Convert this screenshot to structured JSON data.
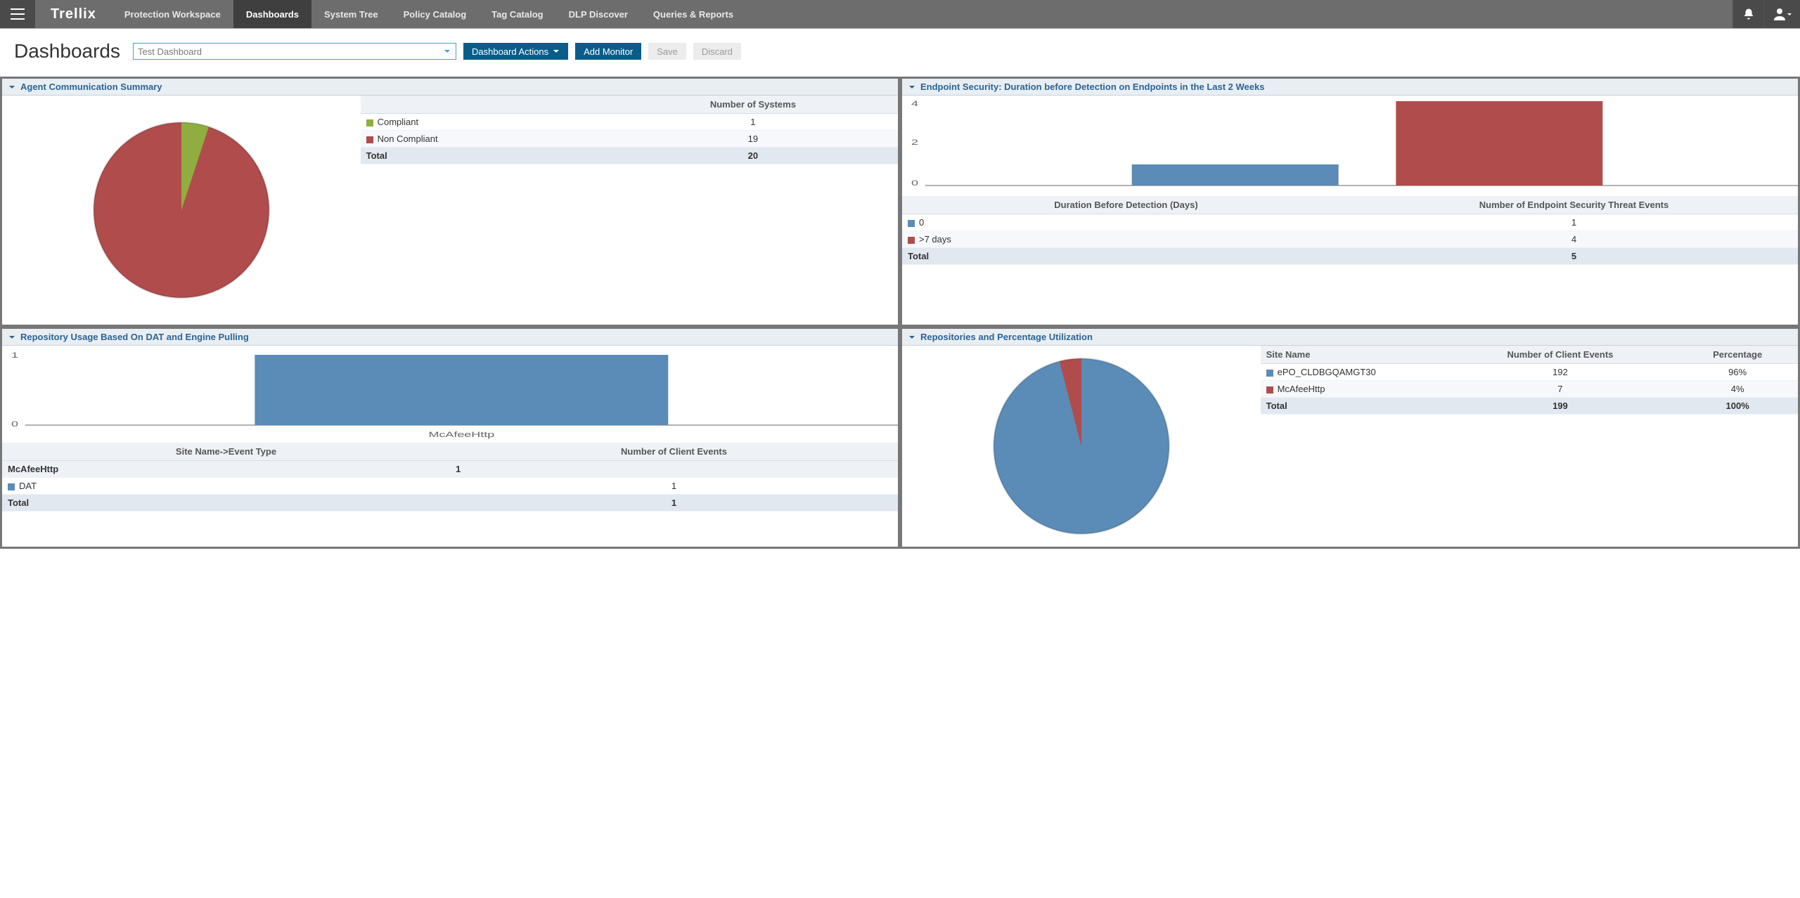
{
  "brand": "Trellix",
  "nav": {
    "items": [
      {
        "label": "Protection Workspace"
      },
      {
        "label": "Dashboards",
        "active": true
      },
      {
        "label": "System Tree"
      },
      {
        "label": "Policy Catalog"
      },
      {
        "label": "Tag Catalog"
      },
      {
        "label": "DLP Discover"
      },
      {
        "label": "Queries & Reports"
      }
    ]
  },
  "page": {
    "title": "Dashboards",
    "selected_dashboard": "Test Dashboard",
    "btn_actions": "Dashboard Actions",
    "btn_add": "Add Monitor",
    "btn_save": "Save",
    "btn_discard": "Discard"
  },
  "colors": {
    "blue": "#5b8bb7",
    "red": "#b04c4c",
    "green": "#8fae3f"
  },
  "panels": {
    "agent": {
      "title": "Agent Communication Summary",
      "table": {
        "header_value": "Number of Systems",
        "rows": [
          {
            "color": "#8fae3f",
            "label": "Compliant",
            "value": "1"
          },
          {
            "color": "#b04c4c",
            "label": "Non Compliant",
            "value": "19"
          }
        ],
        "total_label": "Total",
        "total_value": "20"
      }
    },
    "detection": {
      "title": "Endpoint Security: Duration before Detection on Endpoints in the Last 2 Weeks",
      "yticks": [
        "0",
        "2",
        "4"
      ],
      "table": {
        "col1": "Duration Before Detection (Days)",
        "col2": "Number of Endpoint Security Threat Events",
        "rows": [
          {
            "color": "#5b8bb7",
            "label": "0",
            "value": "1"
          },
          {
            "color": "#b04c4c",
            "label": ">7 days",
            "value": "4"
          }
        ],
        "total_label": "Total",
        "total_value": "5"
      }
    },
    "repo_usage": {
      "title": "Repository Usage Based On DAT and Engine Pulling",
      "yticks": [
        "0",
        "1"
      ],
      "xlabel": "McAfeeHttp",
      "table": {
        "col1": "Site Name->Event Type",
        "col2": "Number of Client Events",
        "group": "McAfeeHttp",
        "rows": [
          {
            "color": "#5b8bb7",
            "label": "DAT",
            "value": "1"
          }
        ],
        "total_label": "Total",
        "total_value": "1"
      }
    },
    "repo_pct": {
      "title": "Repositories and Percentage Utilization",
      "table": {
        "col1": "Site Name",
        "col2": "Number of Client Events",
        "col3": "Percentage",
        "rows": [
          {
            "color": "#5b8bb7",
            "label": "ePO_CLDBGQAMGT30",
            "value": "192",
            "pct": "96%"
          },
          {
            "color": "#b04c4c",
            "label": "McAfeeHttp",
            "value": "7",
            "pct": "4%"
          }
        ],
        "total_label": "Total",
        "total_value": "199",
        "total_pct": "100%"
      }
    }
  },
  "chart_data": [
    {
      "type": "pie",
      "title": "Agent Communication Summary",
      "series": [
        {
          "name": "Compliant",
          "value": 1,
          "color": "#8fae3f"
        },
        {
          "name": "Non Compliant",
          "value": 19,
          "color": "#b04c4c"
        }
      ],
      "total": 20
    },
    {
      "type": "bar",
      "title": "Endpoint Security: Duration before Detection on Endpoints in the Last 2 Weeks",
      "xlabel": "",
      "ylabel": "",
      "categories": [
        "0",
        ">7 days"
      ],
      "values": [
        1,
        4
      ],
      "colors": [
        "#5b8bb7",
        "#b04c4c"
      ],
      "ylim": [
        0,
        4
      ]
    },
    {
      "type": "bar",
      "title": "Repository Usage Based On DAT and Engine Pulling",
      "categories": [
        "McAfeeHttp"
      ],
      "values": [
        1
      ],
      "colors": [
        "#5b8bb7"
      ],
      "ylim": [
        0,
        1
      ]
    },
    {
      "type": "pie",
      "title": "Repositories and Percentage Utilization",
      "series": [
        {
          "name": "ePO_CLDBGQAMGT30",
          "value": 192,
          "pct": 96,
          "color": "#5b8bb7"
        },
        {
          "name": "McAfeeHttp",
          "value": 7,
          "pct": 4,
          "color": "#b04c4c"
        }
      ],
      "total": 199
    }
  ]
}
